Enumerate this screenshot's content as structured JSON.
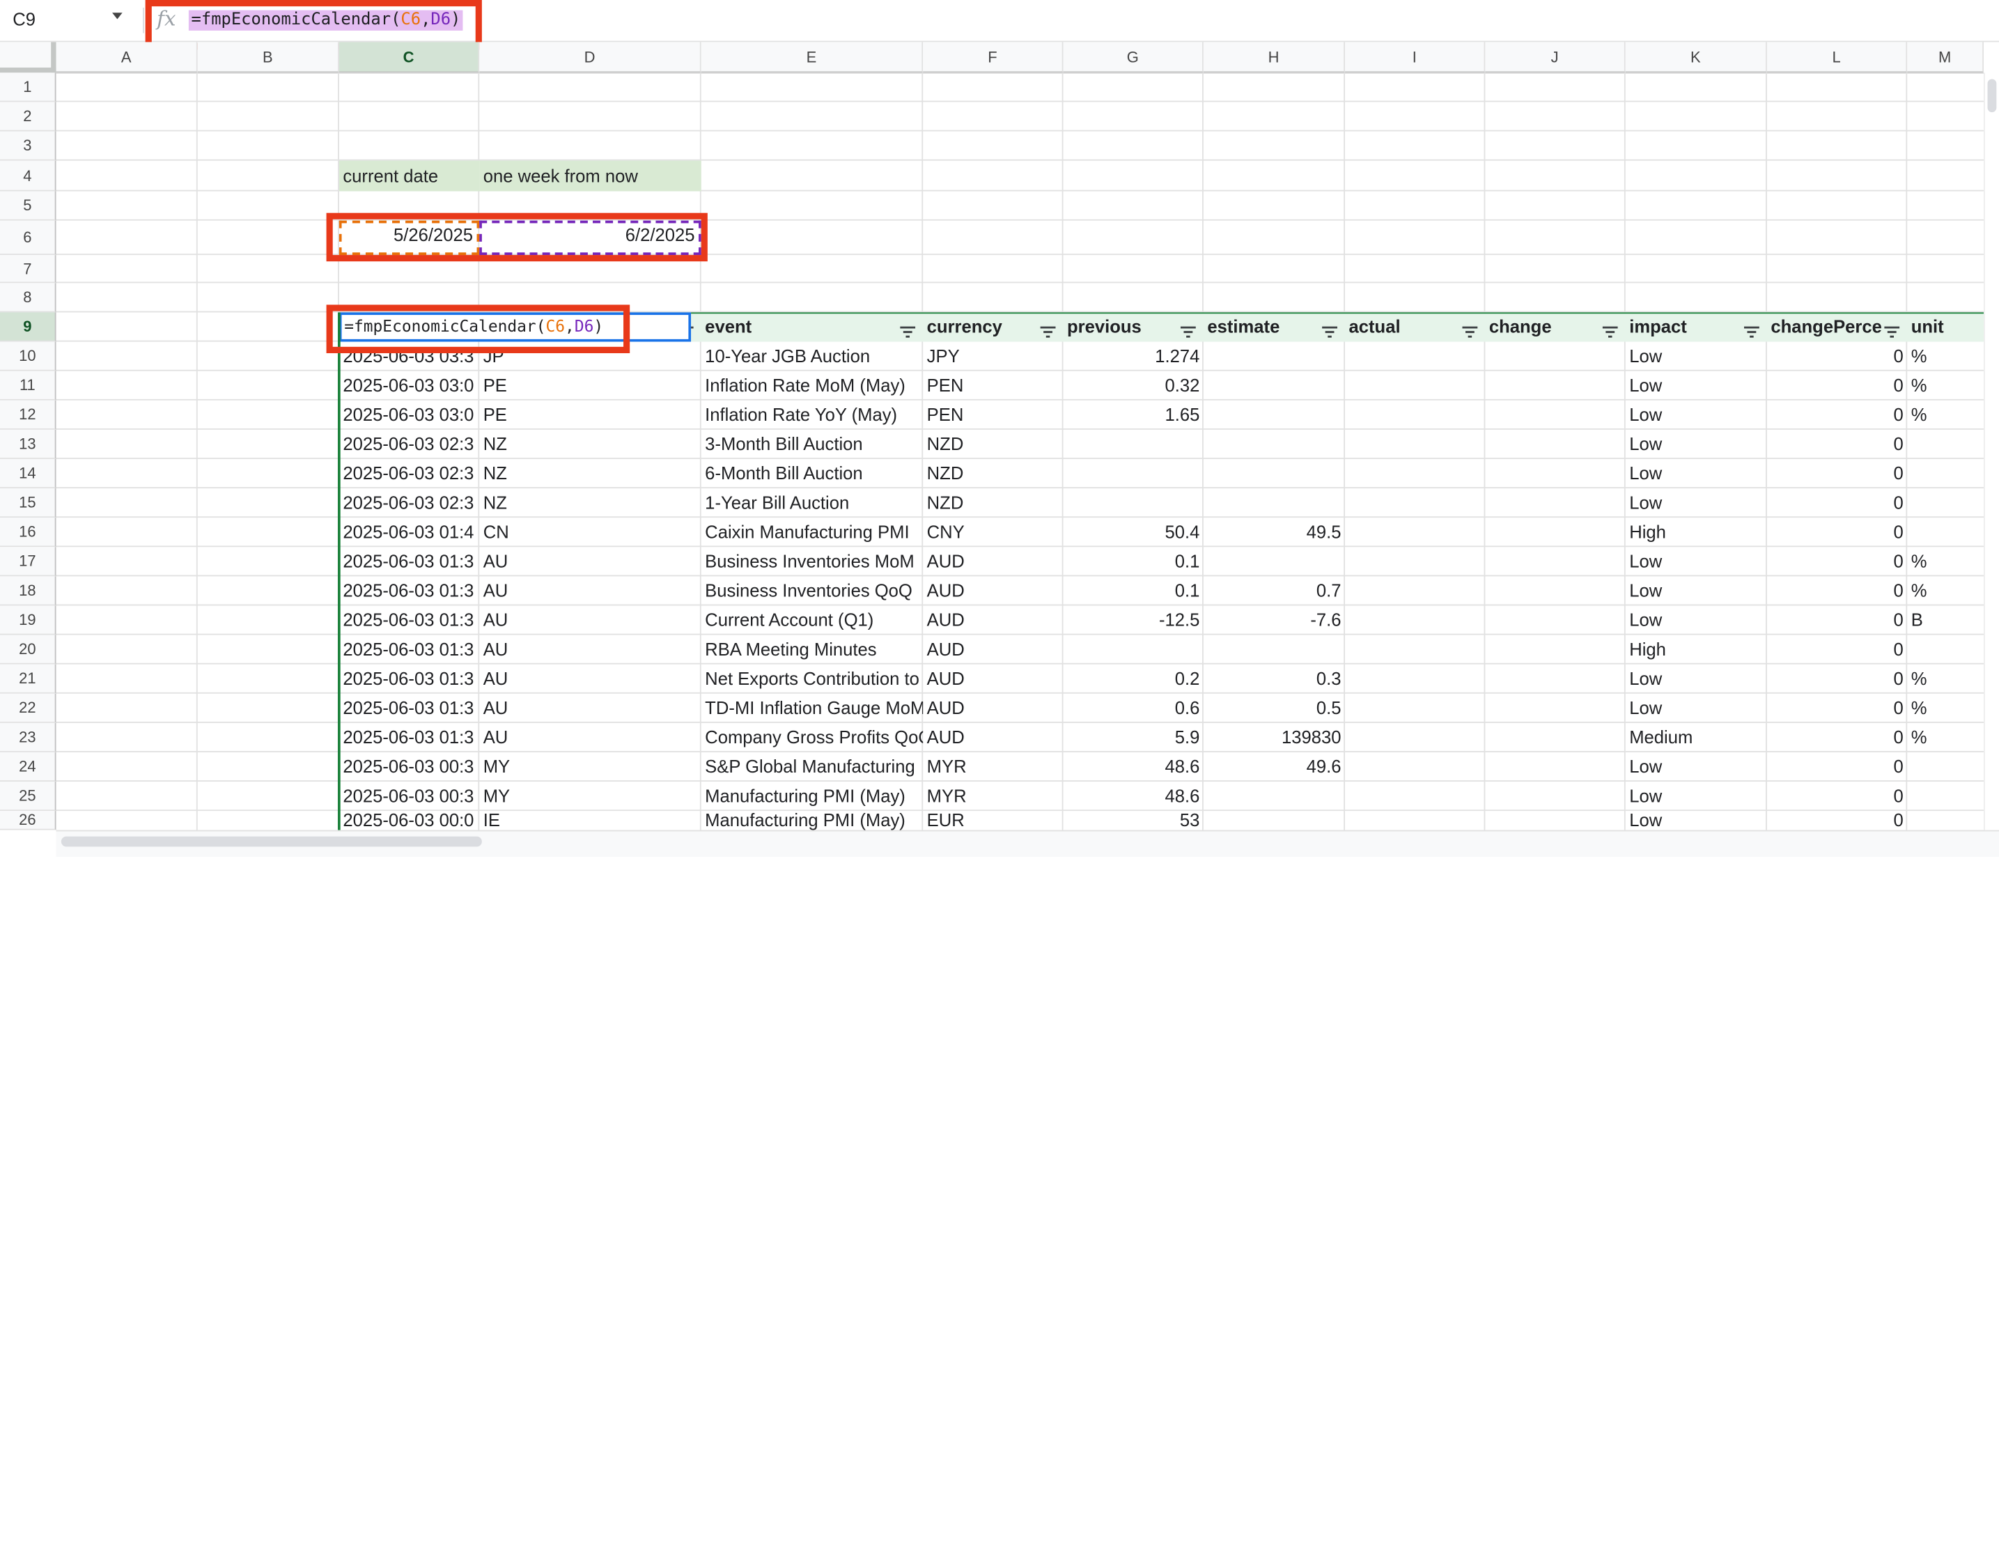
{
  "name_box": "C9",
  "formula_bar": {
    "fn": "=fmpEconomicCalendar(",
    "arg1": "C6",
    "sep": ",",
    "arg2": "D6",
    "close": ")"
  },
  "columns": [
    "A",
    "B",
    "C",
    "D",
    "E",
    "F",
    "G",
    "H",
    "I",
    "J",
    "K",
    "L",
    "M"
  ],
  "rows": [
    "1",
    "2",
    "3",
    "4",
    "5",
    "6",
    "7",
    "8",
    "9",
    "10",
    "11",
    "12",
    "13",
    "14",
    "15",
    "16",
    "17",
    "18",
    "19",
    "20",
    "21",
    "22",
    "23",
    "24",
    "25",
    "26"
  ],
  "labels": {
    "current_date": "current date",
    "one_week": "one week from now"
  },
  "dates": {
    "c6": "5/26/2025",
    "d6": "6/2/2025"
  },
  "editing_formula": {
    "fn": "=fmpEconomicCalendar(",
    "arg1": "C6",
    "sep": ",",
    "arg2": "D6",
    "close": ")"
  },
  "table_headers": [
    "",
    "event",
    "currency",
    "previous",
    "estimate",
    "actual",
    "change",
    "impact",
    "changePerce",
    "unit"
  ],
  "table_rows": [
    [
      "2025-06-03 03:3",
      "JP",
      "10-Year JGB Auction",
      "JPY",
      "1.274",
      "",
      "",
      "",
      "Low",
      "0",
      "%"
    ],
    [
      "2025-06-03 03:0",
      "PE",
      "Inflation Rate MoM (May)",
      "PEN",
      "0.32",
      "",
      "",
      "",
      "Low",
      "0",
      "%"
    ],
    [
      "2025-06-03 03:0",
      "PE",
      "Inflation Rate YoY (May)",
      "PEN",
      "1.65",
      "",
      "",
      "",
      "Low",
      "0",
      "%"
    ],
    [
      "2025-06-03 02:3",
      "NZ",
      "3-Month Bill Auction",
      "NZD",
      "",
      "",
      "",
      "",
      "Low",
      "0",
      ""
    ],
    [
      "2025-06-03 02:3",
      "NZ",
      "6-Month Bill Auction",
      "NZD",
      "",
      "",
      "",
      "",
      "Low",
      "0",
      ""
    ],
    [
      "2025-06-03 02:3",
      "NZ",
      "1-Year Bill Auction",
      "NZD",
      "",
      "",
      "",
      "",
      "Low",
      "0",
      ""
    ],
    [
      "2025-06-03 01:4",
      "CN",
      "Caixin Manufacturing PMI",
      "CNY",
      "50.4",
      "49.5",
      "",
      "",
      "High",
      "0",
      ""
    ],
    [
      "2025-06-03 01:3",
      "AU",
      "Business Inventories MoM",
      "AUD",
      "0.1",
      "",
      "",
      "",
      "Low",
      "0",
      "%"
    ],
    [
      "2025-06-03 01:3",
      "AU",
      "Business Inventories QoQ",
      "AUD",
      "0.1",
      "0.7",
      "",
      "",
      "Low",
      "0",
      "%"
    ],
    [
      "2025-06-03 01:3",
      "AU",
      "Current Account (Q1)",
      "AUD",
      "-12.5",
      "-7.6",
      "",
      "",
      "Low",
      "0",
      "B"
    ],
    [
      "2025-06-03 01:3",
      "AU",
      "RBA Meeting Minutes",
      "AUD",
      "",
      "",
      "",
      "",
      "High",
      "0",
      ""
    ],
    [
      "2025-06-03 01:3",
      "AU",
      "Net Exports Contribution to",
      "AUD",
      "0.2",
      "0.3",
      "",
      "",
      "Low",
      "0",
      "%"
    ],
    [
      "2025-06-03 01:3",
      "AU",
      "TD-MI Inflation Gauge MoM",
      "AUD",
      "0.6",
      "0.5",
      "",
      "",
      "Low",
      "0",
      "%"
    ],
    [
      "2025-06-03 01:3",
      "AU",
      "Company Gross Profits QoQ",
      "AUD",
      "5.9",
      "139830",
      "",
      "",
      "Medium",
      "0",
      "%"
    ],
    [
      "2025-06-03 00:3",
      "MY",
      "S&P Global Manufacturing",
      "MYR",
      "48.6",
      "49.6",
      "",
      "",
      "Low",
      "0",
      ""
    ],
    [
      "2025-06-03 00:3",
      "MY",
      "Manufacturing PMI (May)",
      "MYR",
      "48.6",
      "",
      "",
      "",
      "Low",
      "0",
      ""
    ],
    [
      "2025-06-03 00:0",
      "IE",
      "Manufacturing PMI (May)",
      "EUR",
      "53",
      "",
      "",
      "",
      "Low",
      "0",
      ""
    ]
  ]
}
